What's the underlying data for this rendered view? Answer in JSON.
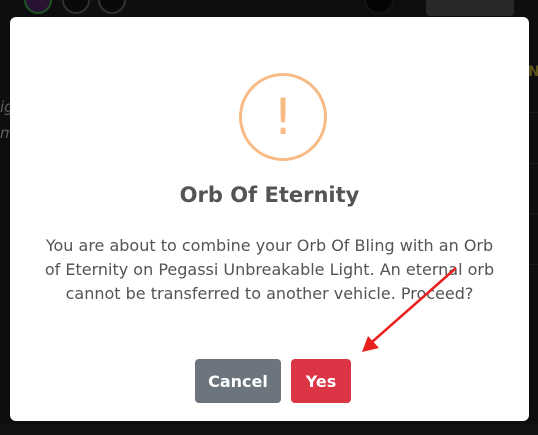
{
  "background": {
    "side_text_1": "igl",
    "side_text_2": "m",
    "right_letter": "N"
  },
  "dialog": {
    "icon_glyph": "!",
    "icon_color": "#f8bb86",
    "title": "Orb Of Eternity",
    "message": "You are about to combine your Orb Of Bling with an Orb of Eternity on Pegassi Unbreakable Light. An eternal orb cannot be transferred to another vehicle. Proceed?",
    "cancel_label": "Cancel",
    "confirm_label": "Yes",
    "cancel_color": "#6c757d",
    "confirm_color": "#dc3545"
  },
  "annotation": {
    "arrow_color": "#e8201e"
  }
}
